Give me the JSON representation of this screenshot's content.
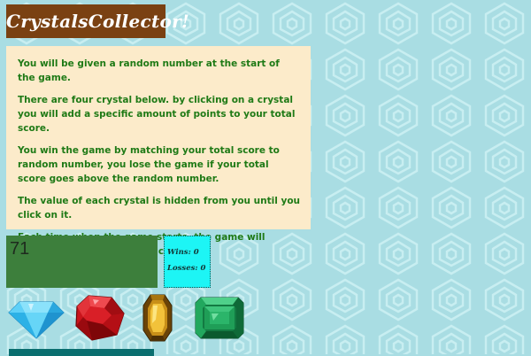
{
  "game": {
    "title": "CrystalsCollector!",
    "instructions": [
      "You will be given a random number at the start of the game.",
      "There are four crystal below. by clicking on a crystal you will add a specific amount of points to your total score.",
      "You win the game by matching your total score to random number, you lose the game if your total score goes above the random number.",
      "The value of each crystal is hidden from you until you click on it.",
      "Each time when the game starts, the game will change the values of each crystal."
    ],
    "random_number": "71",
    "stats": {
      "wins_text": "Wins: 0",
      "losses_text": "Losses: 0"
    },
    "crystals": [
      {
        "name": "blue-diamond",
        "icon": "diamond-icon",
        "color": "#3fc3f0"
      },
      {
        "name": "red-ruby",
        "icon": "ruby-icon",
        "color": "#c9141b"
      },
      {
        "name": "yellow-topaz",
        "icon": "topaz-icon",
        "color": "#c88f18"
      },
      {
        "name": "green-emerald",
        "icon": "emerald-icon",
        "color": "#1f9e57"
      }
    ]
  },
  "colors": {
    "background": "#a9dde3",
    "title_banner": "#7a4112",
    "instructions_bg": "#fcebca",
    "instructions_text": "#1f7a16",
    "score_box": "#3d7f3c",
    "stats_box": "#1df5f5"
  }
}
